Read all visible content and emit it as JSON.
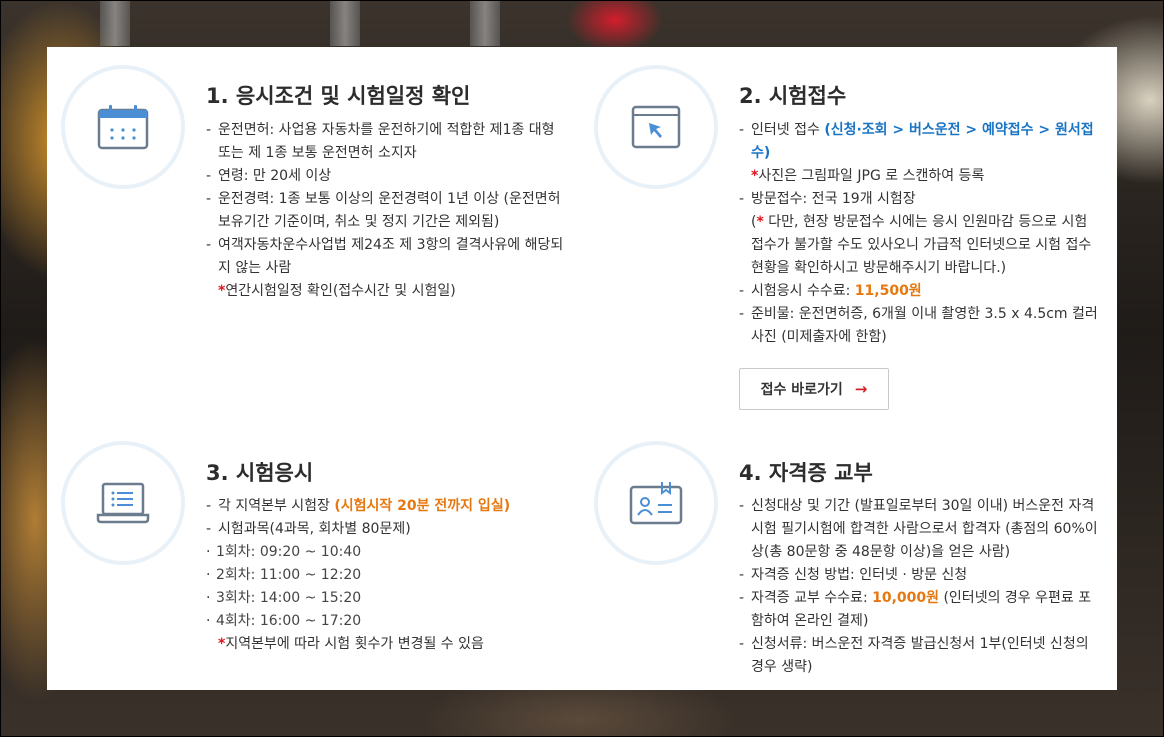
{
  "steps": [
    {
      "title": "1. 응시조건 및 시험일정 확인",
      "icon": "calendar-icon",
      "items": [
        "운전면허: 사업용 자동차를 운전하기에 적합한 제1종 대형 또는 제 1종 보통 운전면허 소지자",
        "연령: 만 20세 이상",
        "운전경력: 1종 보통 이상의 운전경력이 1년 이상 (운전면허 보유기간 기준이며, 취소 및 정지 기간은 제외됨)",
        "여객자동차운수사업법 제24조 제 3항의 결격사유에 해당되지 않는 사람"
      ],
      "note": "연간시험일정 확인(접수시간 및 시험일)"
    },
    {
      "title": "2. 시험접수",
      "icon": "cursor-window-icon",
      "internet_prefix": "인터넷 접수 ",
      "internet_path": "(신청·조회 > 버스운전 > 예약접수 > 원서접수)",
      "photo_note": "사진은 그림파일 JPG 로 스캔하여 등록",
      "visit": "방문접수: 전국 19개 시험장",
      "visit_note": "다만, 현장 방문접수 시에는 응시 인원마감 등으로 시험 접수가 불가할 수도 있사오니 가급적 인터넷으로 시험 접수현황을 확인하시고 방문해주시기 바랍니다.)",
      "visit_note_open": "(",
      "fee_label": "시험응시 수수료: ",
      "fee_value": "11,500원",
      "prep": "준비물: 운전면허증, 6개월 이내 촬영한 3.5 x 4.5cm 컬러사진 (미제출자에 한함)",
      "button_label": "접수 바로가기",
      "button_arrow": "→"
    },
    {
      "title": "3. 시험응시",
      "icon": "laptop-list-icon",
      "venue_prefix": "각 지역본부 시험장 ",
      "venue_highlight": "(시험시작 20분 전까지 입실)",
      "subjects": "시험과목(4과목, 회차별 80문제)",
      "sessions": [
        "1회차: 09:20 ~ 10:40",
        "2회차: 11:00 ~ 12:20",
        "3회차: 14:00 ~ 15:20",
        "4회차: 16:00 ~ 17:20"
      ],
      "note": "지역본부에 따라 시험 횟수가 변경될 수 있음"
    },
    {
      "title": "4. 자격증 교부",
      "icon": "id-card-icon",
      "target": "신청대상 및 기간 (발표일로부터 30일 이내) 버스운전 자격시험 필기시험에 합격한 사람으로서 합격자 (총점의 60%이상(총 80문항 중 48문항 이상)을 얻은 사람)",
      "method": "자격증 신청 방법: 인터넷 · 방문 신청",
      "fee_label": "자격증 교부 수수료: ",
      "fee_value": "10,000원",
      "fee_suffix": " (인터넷의 경우 우편료 포함하여 온라인 결제)",
      "docs": "신청서류: 버스운전 자격증 발급신청서 1부(인터넷 신청의 경우 생략)"
    }
  ],
  "star": "*",
  "colors": {
    "accent_blue": "#1a74c5",
    "accent_orange": "#e6780f",
    "star_red": "#e1121b",
    "icon_blue": "#4a8fd6"
  }
}
